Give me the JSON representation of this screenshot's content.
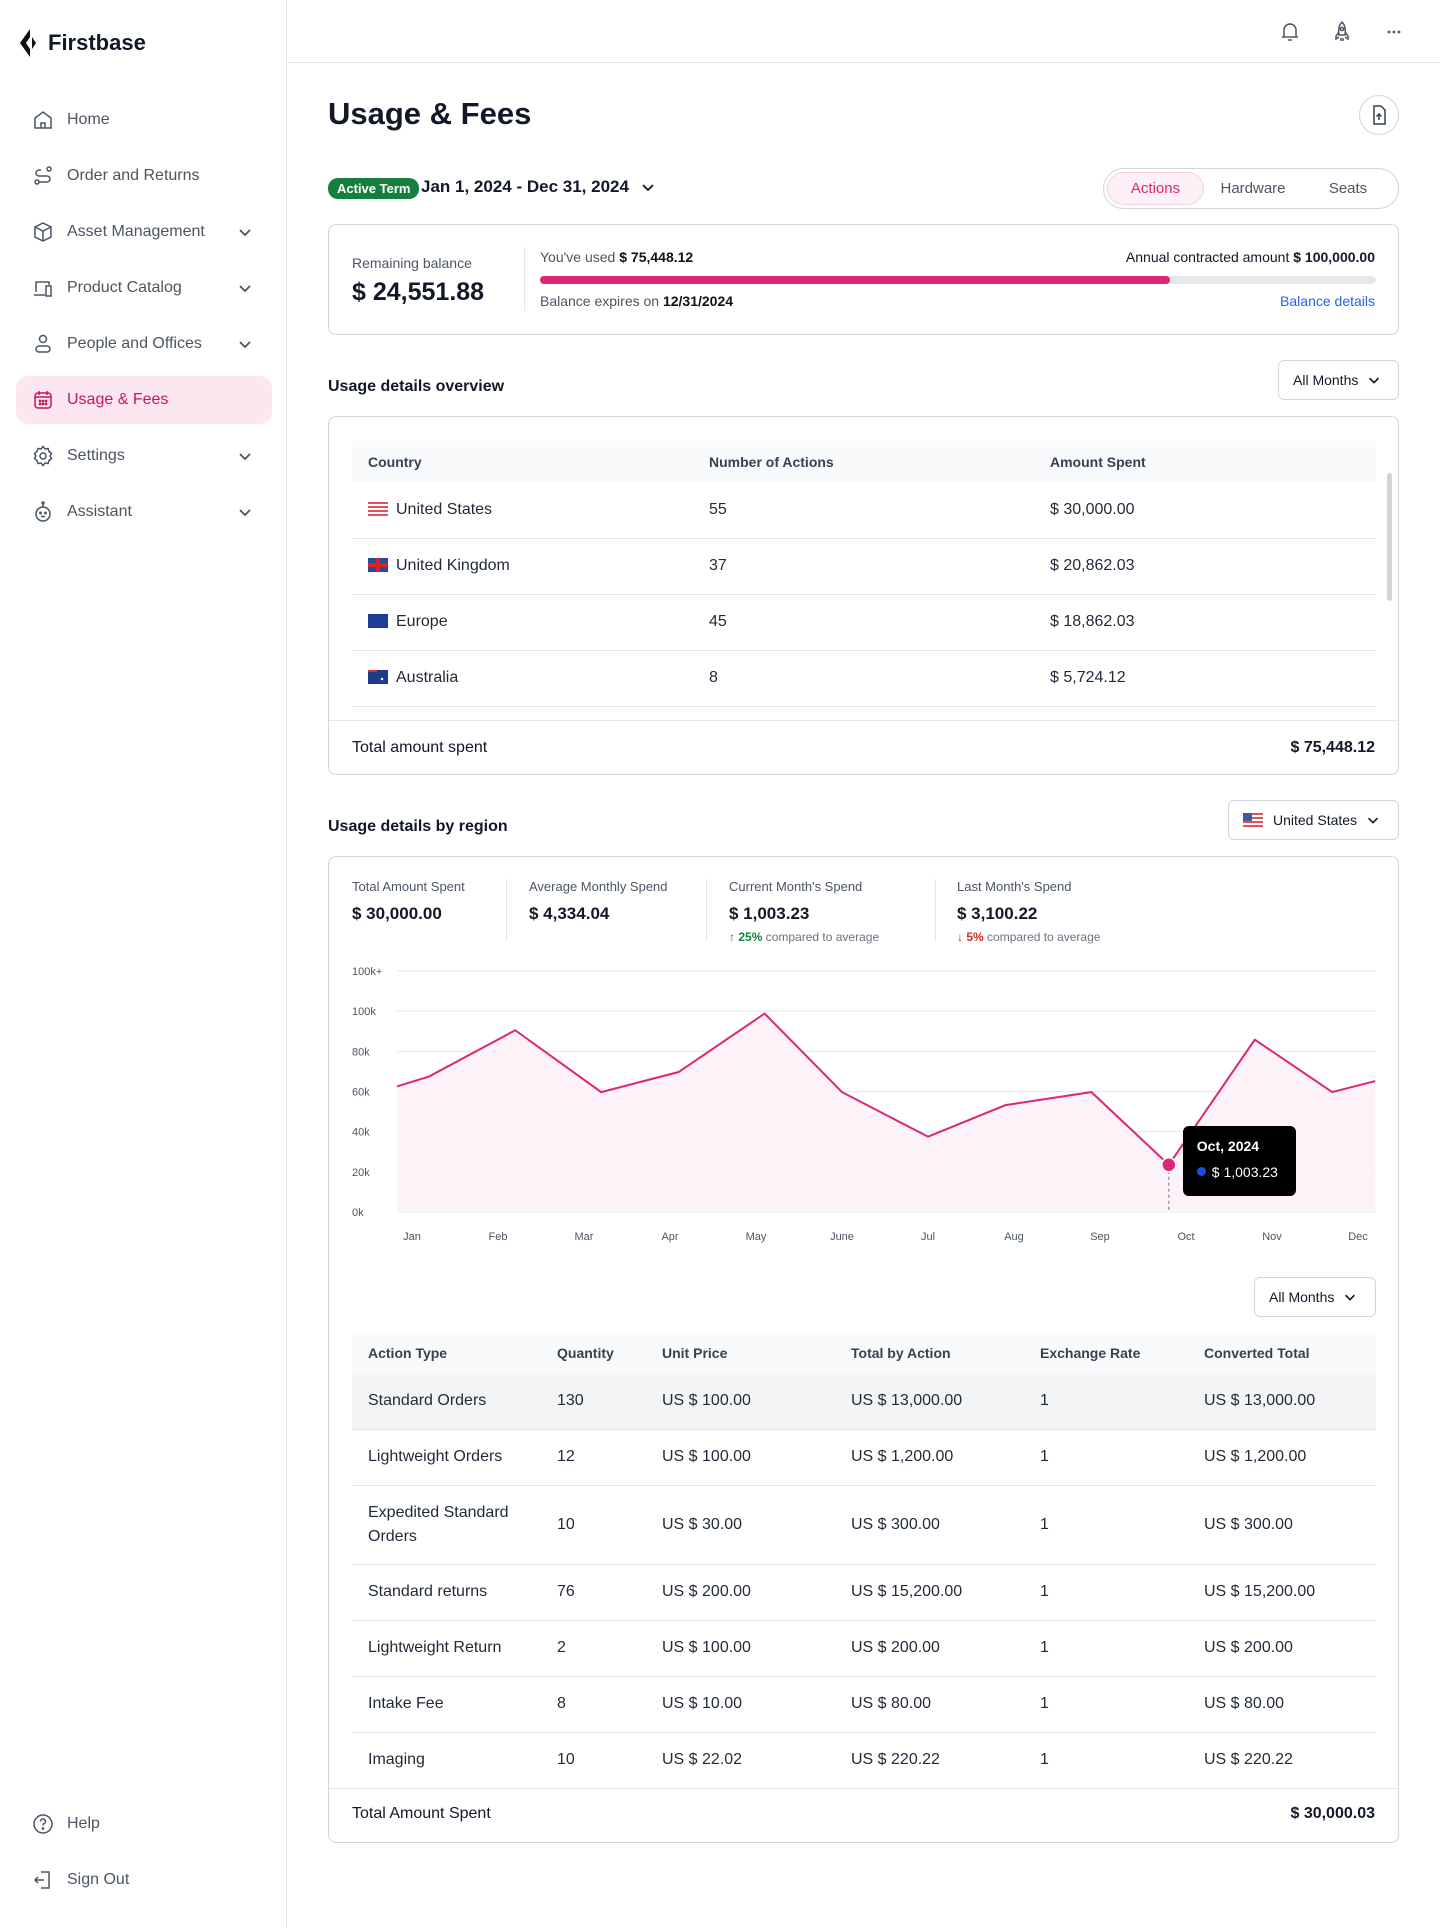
{
  "brand": "Firstbase",
  "sidebar": {
    "items": [
      {
        "label": "Home"
      },
      {
        "label": "Order and Returns"
      },
      {
        "label": "Asset Management"
      },
      {
        "label": "Product Catalog"
      },
      {
        "label": "People and Offices"
      },
      {
        "label": "Usage & Fees"
      },
      {
        "label": "Settings"
      },
      {
        "label": "Assistant"
      }
    ],
    "help": "Help",
    "signout": "Sign Out"
  },
  "page": {
    "title": "Usage & Fees",
    "badge": "Active Term",
    "term": "Jan 1, 2024 - Dec 31, 2024",
    "tabs": [
      "Actions",
      "Hardware",
      "Seats"
    ]
  },
  "balance": {
    "remaining_label": "Remaining balance",
    "remaining": "$ 24,551.88",
    "used_label": "You've used",
    "used": "$ 75,448.12",
    "annual_label": "Annual contracted amount",
    "annual": "$ 100,000.00",
    "progress": 0.754,
    "expires_label": "Balance expires on",
    "expires": "12/31/2024",
    "details_link": "Balance details"
  },
  "overview": {
    "title": "Usage details overview",
    "filter": "All Months",
    "headers": [
      "Country",
      "Number of Actions",
      "Amount Spent"
    ],
    "rows": [
      {
        "country": "United States",
        "flag": "us",
        "actions": "55",
        "amount": "$ 30,000.00"
      },
      {
        "country": "United Kingdom",
        "flag": "uk",
        "actions": "37",
        "amount": "$ 20,862.03"
      },
      {
        "country": "Europe",
        "flag": "eu",
        "actions": "45",
        "amount": "$ 18,862.03"
      },
      {
        "country": "Australia",
        "flag": "au",
        "actions": "8",
        "amount": "$ 5,724.12"
      }
    ],
    "total_label": "Total amount spent",
    "total": "$ 75,448.12"
  },
  "region": {
    "title": "Usage details by region",
    "selected": "United States",
    "stats": [
      {
        "label": "Total Amount Spent",
        "value": "$ 30,000.00"
      },
      {
        "label": "Average Monthly Spend",
        "value": "$ 4,334.04"
      },
      {
        "label": "Current Month's Spend",
        "value": "$ 1,003.23",
        "delta": "25%",
        "delta_text": "compared to average",
        "dir": "up"
      },
      {
        "label": "Last Month's Spend",
        "value": "$ 3,100.22",
        "delta": "5%",
        "delta_text": "compared to average",
        "dir": "down"
      }
    ],
    "filter": "All Months",
    "headers": [
      "Action Type",
      "Quantity",
      "Unit Price",
      "Total by Action",
      "Exchange Rate",
      "Converted Total"
    ],
    "rows": [
      [
        "Standard Orders",
        "130",
        "US $ 100.00",
        "US $ 13,000.00",
        "1",
        "US $ 13,000.00"
      ],
      [
        "Lightweight Orders",
        "12",
        "US $ 100.00",
        "US $ 1,200.00",
        "1",
        "US $ 1,200.00"
      ],
      [
        "Expedited Standard Orders",
        "10",
        "US $ 30.00",
        "US $ 300.00",
        "1",
        "US $ 300.00"
      ],
      [
        "Standard returns",
        "76",
        "US $ 200.00",
        "US $ 15,200.00",
        "1",
        "US $ 15,200.00"
      ],
      [
        "Lightweight Return",
        "2",
        "US $ 100.00",
        "US $ 200.00",
        "1",
        "US $ 200.00"
      ],
      [
        "Intake Fee",
        "8",
        "US $ 10.00",
        "US $ 80.00",
        "1",
        "US $ 80.00"
      ],
      [
        "Imaging",
        "10",
        "US $ 22.02",
        "US $ 220.22",
        "1",
        "US $ 220.22"
      ]
    ],
    "total_label": "Total Amount Spent",
    "total": "$ 30,000.03"
  },
  "chart_data": {
    "type": "line",
    "categories": [
      "Jan",
      "Feb",
      "Mar",
      "Apr",
      "May",
      "June",
      "Jul",
      "Aug",
      "Sep",
      "Oct",
      "Nov",
      "Dec"
    ],
    "x": [
      -0.2,
      0.2,
      1.2,
      2.2,
      3.1,
      4.1,
      5.0,
      6.0,
      6.9,
      7.9,
      8.8,
      9.8,
      10.7,
      11.2
    ],
    "values": [
      62.5,
      67.5,
      90.5,
      59.7,
      69.7,
      98.8,
      59.7,
      37.5,
      53.2,
      59.7,
      23.5,
      85.8,
      59.7,
      65.2
    ],
    "y_ticks": [
      "0k",
      "20k",
      "40k",
      "60k",
      "80k",
      "100k",
      "100k+"
    ],
    "ylim": [
      0,
      120
    ],
    "grid": true,
    "tooltip": {
      "title": "Oct, 2024",
      "value": "$ 1,003.23",
      "index": 10
    },
    "color": "#db2777"
  }
}
